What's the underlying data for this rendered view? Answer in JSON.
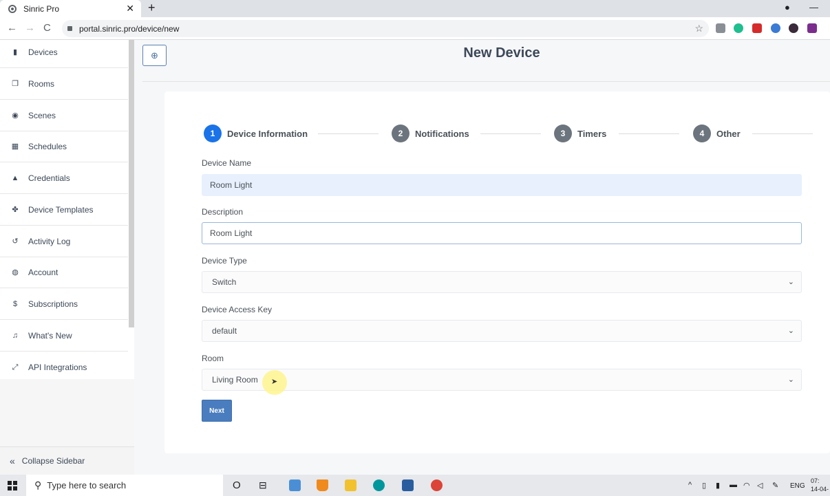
{
  "browser": {
    "tab_title": "Sinric Pro",
    "tab_close": "✕",
    "new_tab": "+",
    "url": "portal.sinric.pro/device/new",
    "back": "←",
    "forward": "→",
    "reload": "C",
    "star": "☆",
    "minimize": "—",
    "profile": "●"
  },
  "sidebar": {
    "items": [
      {
        "label": "Devices",
        "icon": "device-icon",
        "glyph": "▮"
      },
      {
        "label": "Rooms",
        "icon": "rooms-icon",
        "glyph": "❐"
      },
      {
        "label": "Scenes",
        "icon": "scenes-icon",
        "glyph": "◉"
      },
      {
        "label": "Schedules",
        "icon": "calendar-icon",
        "glyph": "▦"
      },
      {
        "label": "Credentials",
        "icon": "lock-icon",
        "glyph": "▲"
      },
      {
        "label": "Device Templates",
        "icon": "cubes-icon",
        "glyph": "✤"
      },
      {
        "label": "Activity Log",
        "icon": "history-icon",
        "glyph": "↺"
      },
      {
        "label": "Account",
        "icon": "user-circle-icon",
        "glyph": "◍"
      },
      {
        "label": "Subscriptions",
        "icon": "dollar-icon",
        "glyph": "$"
      },
      {
        "label": "What's New",
        "icon": "bell-icon",
        "glyph": "♫"
      },
      {
        "label": "API Integrations",
        "icon": "expand-icon",
        "glyph": "⤢"
      }
    ],
    "collapse_label": "Collapse Sidebar",
    "collapse_glyph": "«"
  },
  "header": {
    "back_glyph": "⊕",
    "title": "New Device"
  },
  "stepper": {
    "steps": [
      {
        "number": "1",
        "label": "Device Information"
      },
      {
        "number": "2",
        "label": "Notifications"
      },
      {
        "number": "3",
        "label": "Timers"
      },
      {
        "number": "4",
        "label": "Other"
      }
    ],
    "active_step": "1"
  },
  "form": {
    "device_name": {
      "label": "Device Name",
      "value": "Room Light"
    },
    "description": {
      "label": "Description",
      "value": "Room Light"
    },
    "device_type": {
      "label": "Device Type",
      "value": "Switch"
    },
    "access_key": {
      "label": "Device Access Key",
      "value": "default"
    },
    "room": {
      "label": "Room",
      "value": "Living Room"
    },
    "chevron": "⌄",
    "next_label": "Next"
  },
  "taskbar": {
    "search_placeholder": "Type here to search",
    "search_glyph": "⚲",
    "cortana": "O",
    "task_view": "⊟",
    "tray_up": "^",
    "language": "ENG",
    "time": "07:",
    "date": "14-04-"
  },
  "colors": {
    "accent": "#1a73e8",
    "button": "#4a7dbf",
    "step_inactive": "#6c757d",
    "autofill": "#e8f0fe"
  }
}
